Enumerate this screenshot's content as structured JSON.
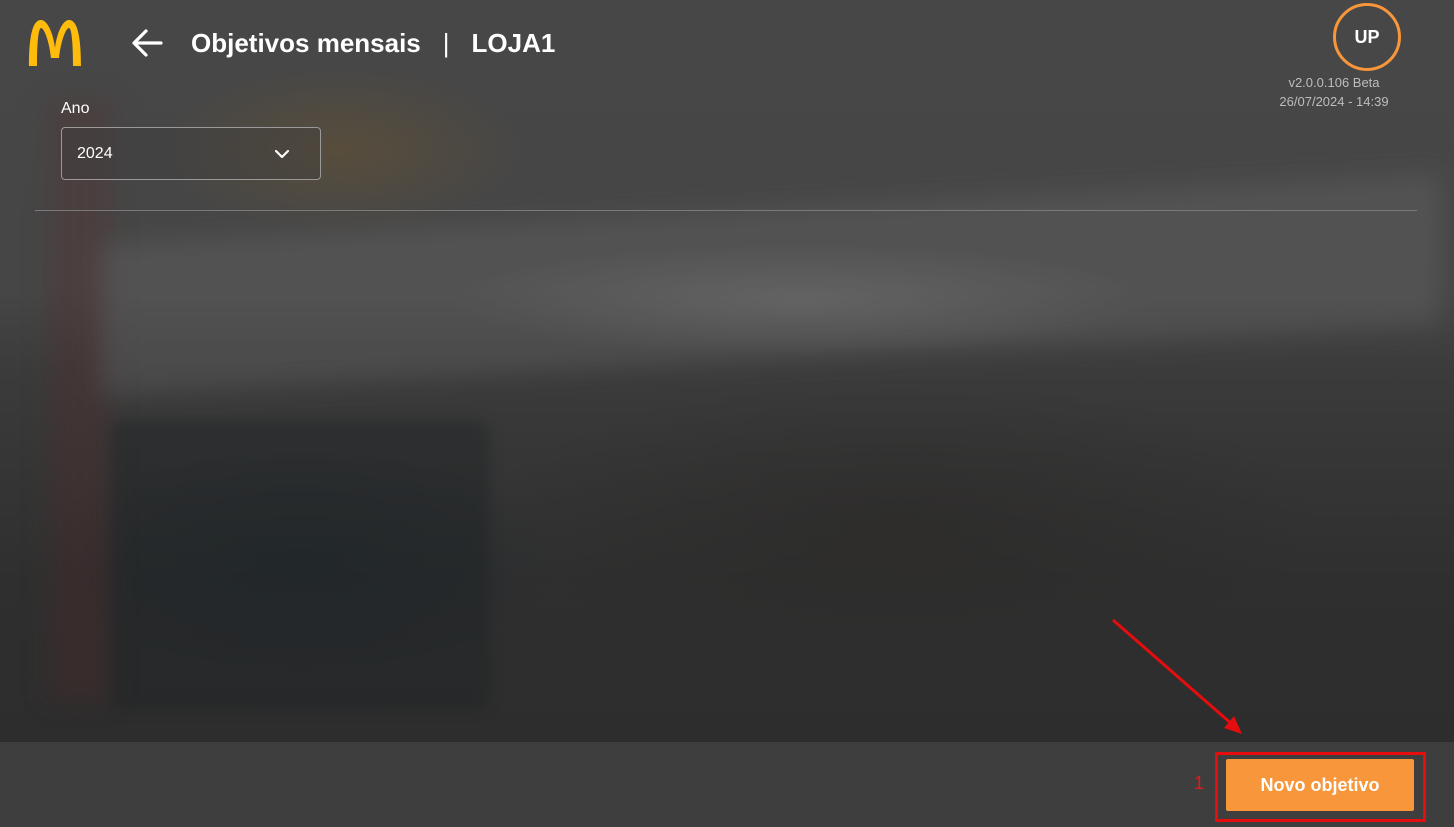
{
  "header": {
    "title": "Objetivos mensais",
    "separator": "|",
    "store": "LOJA1"
  },
  "user": {
    "initials": "UP",
    "version": "v2.0.0.106 Beta",
    "datetime": "26/07/2024 - 14:39"
  },
  "filters": {
    "year_label": "Ano",
    "year_value": "2024"
  },
  "footer": {
    "new_goal_label": "Novo objetivo"
  },
  "annotation": {
    "step_number": "1"
  },
  "colors": {
    "accent": "#f7963a",
    "logo": "#ffbc0d",
    "annotation": "#e50d0d"
  },
  "icons": [
    "mcdonalds-logo",
    "back-arrow-icon",
    "chevron-down-icon"
  ]
}
